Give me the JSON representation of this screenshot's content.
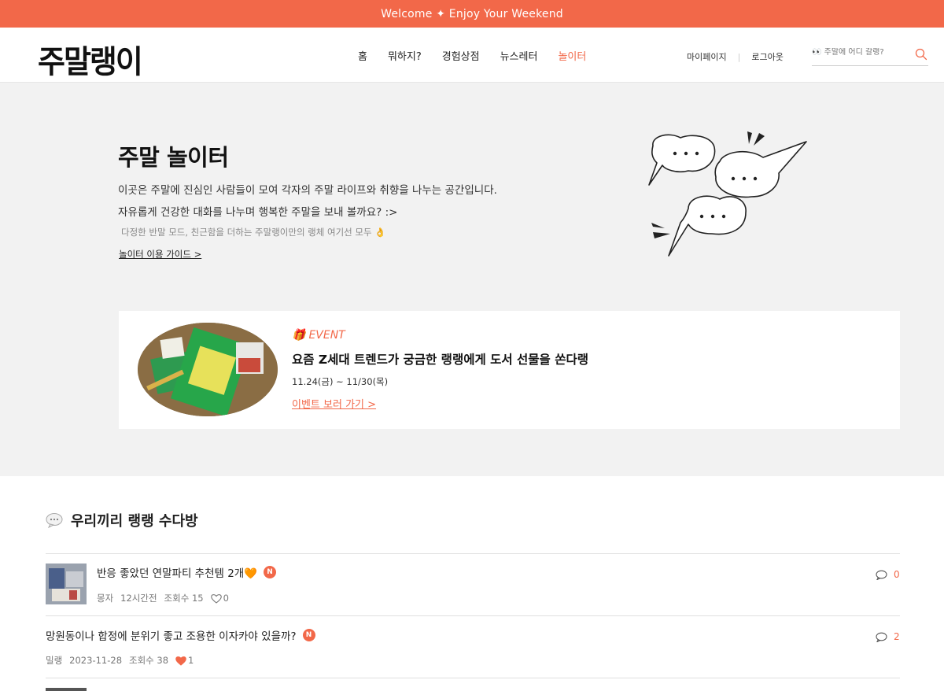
{
  "topbar": {
    "text": "Welcome ✦ Enjoy Your Weekend"
  },
  "header": {
    "logo": "주말랭이",
    "nav": [
      {
        "label": "홈",
        "active": false
      },
      {
        "label": "뭐하지?",
        "active": false
      },
      {
        "label": "경험상점",
        "active": false
      },
      {
        "label": "뉴스레터",
        "active": false
      },
      {
        "label": "놀이터",
        "active": true
      }
    ],
    "util": {
      "mypage": "마이페이지",
      "logout": "로그아웃"
    },
    "search": {
      "placeholder": "👀 주말에 어디 갈랭?"
    }
  },
  "hero": {
    "title": "주말 놀이터",
    "desc1": "이곳은 주말에 진심인 사람들이 모여 각자의 주말 라이프와 취향을 나누는 공간입니다.",
    "desc2": "자유롭게 건강한 대화를 나누며 행복한 주말을 보내 볼까요? :>",
    "note": "다정한 반말 모드, 친근함을 더하는 주말랭이만의 랭체 여기선 모두 👌",
    "guide_link": "놀이터 이용 가이드 >"
  },
  "event": {
    "tag": "EVENT",
    "title": "요즘 Z세대 트렌드가 궁금한 랭랭에게 도서 선물을 쏜다랭",
    "date": "11.24(금) ~ 11/30(목)",
    "link": "이벤트 보러 가기 >"
  },
  "board": {
    "title": "우리끼리 랭랭 수다방",
    "posts": [
      {
        "title": "반응 좋았던 연말파티 추천템 2개🧡",
        "badge": "N",
        "author": "몽자",
        "time": "12시간전",
        "views": "조회수 15",
        "likes": "0",
        "liked": false,
        "comments": "0"
      },
      {
        "title": "망원동이나 합정에 분위기 좋고 조용한 이자카야 있을까?",
        "badge": "N",
        "author": "밀랭",
        "time": "2023-11-28",
        "views": "조회수 38",
        "likes": "1",
        "liked": true,
        "comments": "2"
      }
    ]
  },
  "colors": {
    "accent": "#f26849",
    "hero_bg": "#f2f2f2"
  }
}
